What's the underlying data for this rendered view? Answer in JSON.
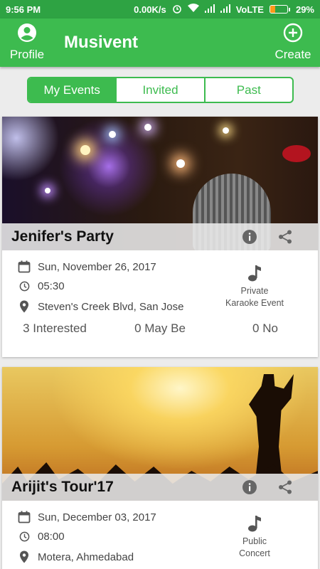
{
  "status_bar": {
    "time": "9:56 PM",
    "network_speed": "0.00K/s",
    "network_type": "VoLTE",
    "battery": "29%",
    "battery_level": 0.29,
    "icons": [
      "alarm-icon",
      "wifi-icon",
      "signal-icon",
      "signal-icon",
      "battery-icon"
    ]
  },
  "header": {
    "title": "Musivent",
    "profile_label": "Profile",
    "create_label": "Create"
  },
  "tabs": [
    {
      "label": "My Events",
      "active": true
    },
    {
      "label": "Invited",
      "active": false
    },
    {
      "label": "Past",
      "active": false
    }
  ],
  "events": [
    {
      "title": "Jenifer's Party",
      "date": "Sun, November 26, 2017",
      "time": "05:30",
      "location": "Steven's Creek Blvd, San Jose",
      "type_line1": "Private",
      "type_line2": "Karaoke Event",
      "interested": "3 Interested",
      "maybe": "0 May Be",
      "no": "0 No"
    },
    {
      "title": "Arijit's Tour'17",
      "date": "Sun, December 03, 2017",
      "time": "08:00",
      "location": "Motera, Ahmedabad",
      "type_line1": "Public",
      "type_line2": "Concert"
    }
  ],
  "colors": {
    "status_bar": "#2ea343",
    "app_bar": "#3dbb4f",
    "accent": "#3dbb4f",
    "battery_fill": "#ff9a1a"
  }
}
